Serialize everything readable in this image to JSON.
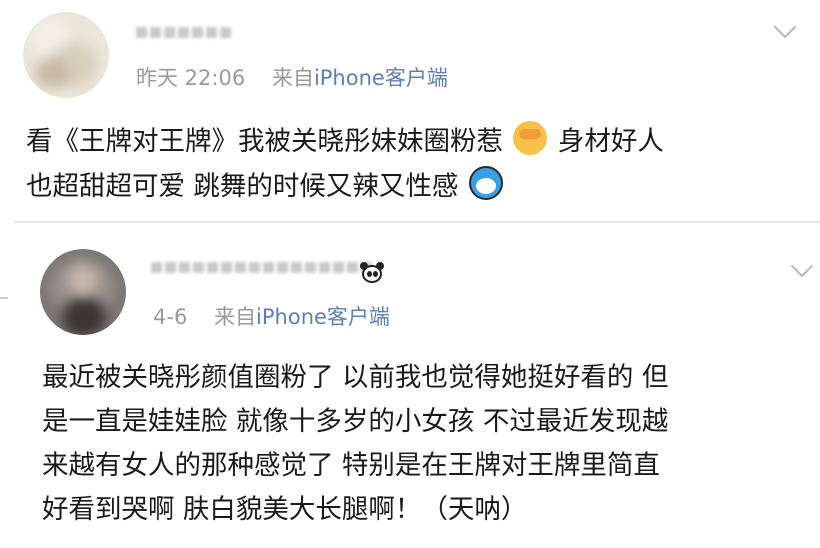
{
  "posts": [
    {
      "time": "昨天 22:06",
      "source_prefix": "来自",
      "source": "iPhone客户端",
      "text_lines": [
        "看《王牌对王牌》我被关晓彤妹妹圈粉惹",
        "身材好人",
        "也超甜超可爱 跳舞的时候又辣又性感"
      ],
      "emojis": [
        "see-no-evil-monkey-emoji",
        "doraemon-emoji"
      ]
    },
    {
      "time": "4-6",
      "source_prefix": "来自",
      "source": "iPhone客户端",
      "text_lines": [
        "最近被关晓彤颜值圈粉了 以前我也觉得她挺好看的 但",
        "是一直是娃娃脸 就像十多岁的小女孩 不过最近发现越",
        "来越有女人的那种感觉了 特别是在王牌对王牌里简直",
        "好看到哭啊 肤白貌美大长腿啊！（天呐）"
      ],
      "emojis": [
        "panda-emoji"
      ]
    }
  ]
}
